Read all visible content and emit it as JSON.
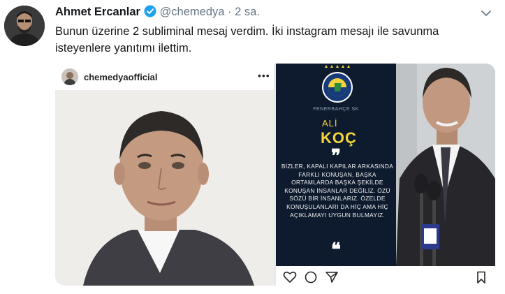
{
  "tweet": {
    "author_name": "Ahmet Ercanlar",
    "handle": "@chemedya",
    "separator": "·",
    "time": "2 sa.",
    "text": "Bunun üzerine 2 subliminal mesaj verdim. İki instagram mesajı ile savunma isteyenlere yanıtımı ilettim."
  },
  "media_left": {
    "instagram_username": "chemedyaofficial",
    "more_glyph": "•••"
  },
  "media_right": {
    "club_name": "FENERBAHÇE SK",
    "first_name": "ALİ",
    "last_name": "KOÇ",
    "open_quote": "❞",
    "quote": "BİZLER, KAPALI KAPILAR ARKASINDA FARKLI KONUŞAN, BAŞKA ORTAMLARDA BAŞKA ŞEKİLDE KONUŞAN İNSANLAR DEĞİLİZ. ÖZÜ SÖZÜ BİR İNSANLARIZ. ÖZELDE KONUŞULANLARI DA HİÇ AMA HİÇ AÇIKLAMAYI UYGUN BULMAYIZ.",
    "close_quote": "❝"
  },
  "icons": {
    "verified": "verified-badge-icon",
    "chevron": "chevron-down-icon",
    "more": "more-options-icon",
    "like": "heart-icon",
    "comment": "comment-icon",
    "share": "send-icon",
    "save": "bookmark-icon"
  },
  "colors": {
    "verified_blue": "#1da1f2",
    "muted_text": "#657786",
    "card_navy": "#0e1b2e",
    "card_yellow": "#f5d33a"
  }
}
